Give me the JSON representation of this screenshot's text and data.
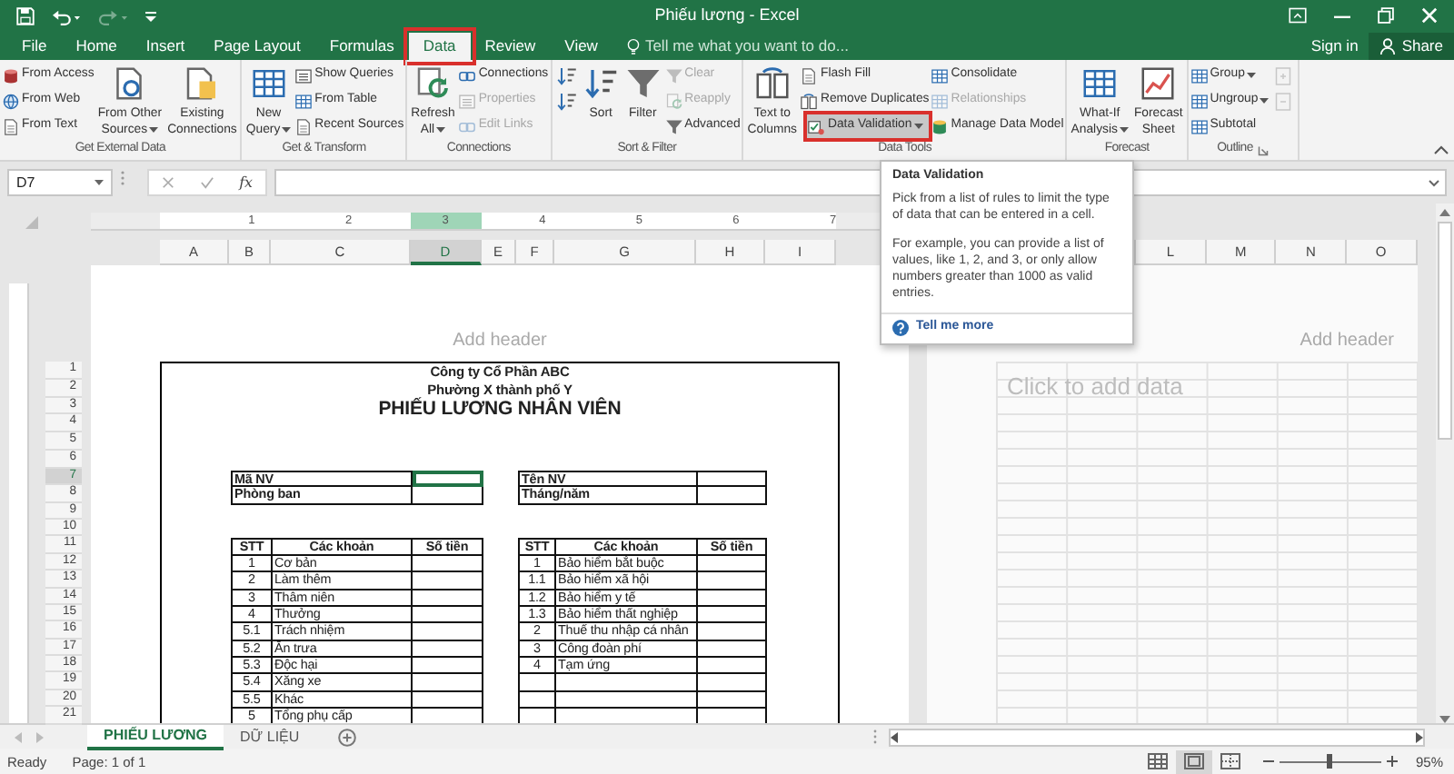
{
  "window": {
    "title": "Phiếu lương - Excel"
  },
  "quick_access": [
    {
      "kind": "save",
      "disabled": false
    },
    {
      "kind": "undo",
      "disabled": false
    },
    {
      "kind": "redo",
      "disabled": true
    },
    {
      "kind": "customize",
      "disabled": false
    }
  ],
  "tabs": [
    {
      "label": "File",
      "selected": false,
      "annotated": false
    },
    {
      "label": "Home",
      "selected": false,
      "annotated": false
    },
    {
      "label": "Insert",
      "selected": false,
      "annotated": false
    },
    {
      "label": "Page Layout",
      "selected": false,
      "annotated": false
    },
    {
      "label": "Formulas",
      "selected": false,
      "annotated": false
    },
    {
      "label": "Data",
      "selected": true,
      "annotated": true
    },
    {
      "label": "Review",
      "selected": false,
      "annotated": false
    },
    {
      "label": "View",
      "selected": false,
      "annotated": false
    }
  ],
  "tell_me": {
    "placeholder": "Tell me what you want to do..."
  },
  "account": {
    "sign_in": "Sign in",
    "share": "Share"
  },
  "ribbon": {
    "groups": [
      {
        "label": "Get External Data",
        "launcher": false,
        "controls": [
          {
            "kind": "stack",
            "buttons": [
              {
                "label": "From Access",
                "disabled": false,
                "dropdown": false,
                "annotated": false
              },
              {
                "label": "From Web",
                "disabled": false,
                "dropdown": false,
                "annotated": false
              },
              {
                "label": "From Text",
                "disabled": false,
                "dropdown": false,
                "annotated": false
              }
            ]
          },
          {
            "kind": "large",
            "lines": [
              "From Other",
              "Sources"
            ],
            "dropdown": true
          },
          {
            "kind": "large",
            "lines": [
              "Existing",
              "Connections"
            ],
            "dropdown": false
          }
        ]
      },
      {
        "label": "Get & Transform",
        "launcher": false,
        "controls": [
          {
            "kind": "large",
            "lines": [
              "New",
              "Query"
            ],
            "dropdown": true
          },
          {
            "kind": "stack",
            "buttons": [
              {
                "label": "Show Queries",
                "disabled": false,
                "dropdown": false,
                "annotated": false
              },
              {
                "label": "From Table",
                "disabled": false,
                "dropdown": false,
                "annotated": false
              },
              {
                "label": "Recent Sources",
                "disabled": false,
                "dropdown": false,
                "annotated": false
              }
            ]
          }
        ]
      },
      {
        "label": "Connections",
        "launcher": false,
        "controls": [
          {
            "kind": "large",
            "lines": [
              "Refresh",
              "All"
            ],
            "dropdown": true
          },
          {
            "kind": "stack",
            "buttons": [
              {
                "label": "Connections",
                "disabled": false,
                "dropdown": false,
                "annotated": false
              },
              {
                "label": "Properties",
                "disabled": true,
                "dropdown": false,
                "annotated": false
              },
              {
                "label": "Edit Links",
                "disabled": true,
                "dropdown": false,
                "annotated": false
              }
            ]
          }
        ]
      },
      {
        "label": "Sort & Filter",
        "launcher": false,
        "controls": [
          {
            "kind": "icons",
            "buttons": [
              {
                "disabled": false
              },
              {
                "disabled": false
              }
            ]
          },
          {
            "kind": "large",
            "lines": [
              "Sort"
            ],
            "dropdown": false
          },
          {
            "kind": "large",
            "lines": [
              "Filter"
            ],
            "dropdown": false
          },
          {
            "kind": "stack",
            "buttons": [
              {
                "label": "Clear",
                "disabled": true,
                "dropdown": false,
                "annotated": false
              },
              {
                "label": "Reapply",
                "disabled": true,
                "dropdown": false,
                "annotated": false
              },
              {
                "label": "Advanced",
                "disabled": false,
                "dropdown": false,
                "annotated": false
              }
            ]
          }
        ]
      },
      {
        "label": "Data Tools",
        "launcher": false,
        "controls": [
          {
            "kind": "large",
            "lines": [
              "Text to",
              "Columns"
            ],
            "dropdown": false
          },
          {
            "kind": "stack",
            "buttons": [
              {
                "label": "Flash Fill",
                "disabled": false,
                "dropdown": false,
                "annotated": false
              },
              {
                "label": "Remove Duplicates",
                "disabled": false,
                "dropdown": false,
                "annotated": false
              },
              {
                "label": "Data Validation",
                "disabled": false,
                "dropdown": true,
                "annotated": true
              }
            ]
          },
          {
            "kind": "stack",
            "buttons": [
              {
                "label": "Consolidate",
                "disabled": false,
                "dropdown": false,
                "annotated": false
              },
              {
                "label": "Relationships",
                "disabled": true,
                "dropdown": false,
                "annotated": false
              },
              {
                "label": "Manage Data Model",
                "disabled": false,
                "dropdown": false,
                "annotated": false
              }
            ]
          }
        ]
      },
      {
        "label": "Forecast",
        "launcher": false,
        "controls": [
          {
            "kind": "large",
            "lines": [
              "What-If",
              "Analysis"
            ],
            "dropdown": true
          },
          {
            "kind": "large",
            "lines": [
              "Forecast",
              "Sheet"
            ],
            "dropdown": false
          }
        ]
      },
      {
        "label": "Outline",
        "launcher": true,
        "controls": [
          {
            "kind": "stack",
            "buttons": [
              {
                "label": "Group",
                "disabled": false,
                "dropdown": true,
                "annotated": false
              },
              {
                "label": "Ungroup",
                "disabled": false,
                "dropdown": true,
                "annotated": false
              },
              {
                "label": "Subtotal",
                "disabled": false,
                "dropdown": false,
                "annotated": false
              }
            ]
          },
          {
            "kind": "icons",
            "buttons": [
              {
                "disabled": true
              },
              {
                "disabled": true
              }
            ]
          }
        ]
      }
    ]
  },
  "tooltip": {
    "title": "Data Validation",
    "paragraphs": [
      "Pick from a list of rules to limit the type of data that can be entered in a cell.",
      "For example, you can provide a list of values, like 1, 2, and 3, or only allow numbers greater than 1000 as valid entries."
    ],
    "link": "Tell me more"
  },
  "formula_bar": {
    "name_box": "D7",
    "function_label": "fx"
  },
  "ruler": {
    "marks": [
      "1",
      "2",
      "3",
      "4",
      "5",
      "6",
      "7"
    ]
  },
  "columns": [
    {
      "label": "A",
      "selected": false
    },
    {
      "label": "B",
      "selected": false
    },
    {
      "label": "C",
      "selected": false
    },
    {
      "label": "D",
      "selected": true
    },
    {
      "label": "E",
      "selected": false
    },
    {
      "label": "F",
      "selected": false
    },
    {
      "label": "G",
      "selected": false
    },
    {
      "label": "H",
      "selected": false
    },
    {
      "label": "I",
      "selected": false
    }
  ],
  "right_columns": [
    {
      "label": "L",
      "selected": false
    },
    {
      "label": "M",
      "selected": false
    },
    {
      "label": "N",
      "selected": false
    },
    {
      "label": "O",
      "selected": false
    }
  ],
  "rows": [
    {
      "label": "1",
      "selected": false
    },
    {
      "label": "2",
      "selected": false
    },
    {
      "label": "3",
      "selected": false
    },
    {
      "label": "4",
      "selected": false
    },
    {
      "label": "5",
      "selected": false
    },
    {
      "label": "6",
      "selected": false
    },
    {
      "label": "7",
      "selected": true
    },
    {
      "label": "8",
      "selected": false
    },
    {
      "label": "9",
      "selected": false
    },
    {
      "label": "10",
      "selected": false
    },
    {
      "label": "11",
      "selected": false
    },
    {
      "label": "12",
      "selected": false
    },
    {
      "label": "13",
      "selected": false
    },
    {
      "label": "14",
      "selected": false
    },
    {
      "label": "15",
      "selected": false
    },
    {
      "label": "16",
      "selected": false
    },
    {
      "label": "17",
      "selected": false
    },
    {
      "label": "18",
      "selected": false
    },
    {
      "label": "19",
      "selected": false
    },
    {
      "label": "20",
      "selected": false
    },
    {
      "label": "21",
      "selected": false
    }
  ],
  "pages": [
    {
      "header_placeholder": "Add header"
    },
    {
      "header_placeholder": "Add header",
      "data_placeholder": "Click to add data"
    }
  ],
  "worksheet": {
    "title_lines": [
      {
        "text": "Công ty Cổ Phần ABC",
        "kind": "subtitle"
      },
      {
        "text": "Phường X thành phố Y",
        "kind": "subtitle"
      },
      {
        "text": "PHIẾU LƯƠNG NHÂN VIÊN",
        "kind": "title"
      }
    ],
    "info_left": [
      {
        "label": "Mã NV",
        "selected": true
      },
      {
        "label": "Phòng ban",
        "selected": false
      }
    ],
    "info_right": [
      {
        "label": "Tên NV",
        "selected": false
      },
      {
        "label": "Tháng/năm",
        "selected": false
      }
    ],
    "tables": [
      {
        "columns": [
          "STT",
          "Các khoản",
          "Số tiền"
        ],
        "rows": [
          {
            "stt": "1",
            "item": "Cơ bản"
          },
          {
            "stt": "2",
            "item": "Làm thêm"
          },
          {
            "stt": "3",
            "item": "Thâm niên"
          },
          {
            "stt": "4",
            "item": "Thưởng"
          },
          {
            "stt": "5.1",
            "item": "Trách nhiệm"
          },
          {
            "stt": "5.2",
            "item": "Ăn trưa"
          },
          {
            "stt": "5.3",
            "item": "Độc hại"
          },
          {
            "stt": "5.4",
            "item": "Xăng xe"
          },
          {
            "stt": "5.5",
            "item": "Khác"
          },
          {
            "stt": "5",
            "item": "Tổng phụ cấp"
          }
        ]
      },
      {
        "columns": [
          "STT",
          "Các khoản",
          "Số tiền"
        ],
        "rows": [
          {
            "stt": "1",
            "item": "Bảo hiểm bắt buộc"
          },
          {
            "stt": "1.1",
            "item": "Bảo hiểm xã hội"
          },
          {
            "stt": "1.2",
            "item": "Bảo hiểm y tế"
          },
          {
            "stt": "1.3",
            "item": "Bảo hiểm thất nghiệp"
          },
          {
            "stt": "2",
            "item": "Thuế thu nhập cá nhân"
          },
          {
            "stt": "3",
            "item": "Công đoàn phí"
          },
          {
            "stt": "4",
            "item": "Tạm ứng"
          }
        ]
      }
    ]
  },
  "sheet_tabs": [
    {
      "label": "PHIẾU LƯƠNG",
      "selected": true
    },
    {
      "label": "DỮ LIỆU",
      "selected": false
    }
  ],
  "status_bar": {
    "mode": "Ready",
    "page": "Page: 1 of 1",
    "views": [
      {
        "selected": false
      },
      {
        "selected": true
      },
      {
        "selected": false
      }
    ],
    "zoom": {
      "level": 0.5,
      "reading": "95%"
    }
  }
}
